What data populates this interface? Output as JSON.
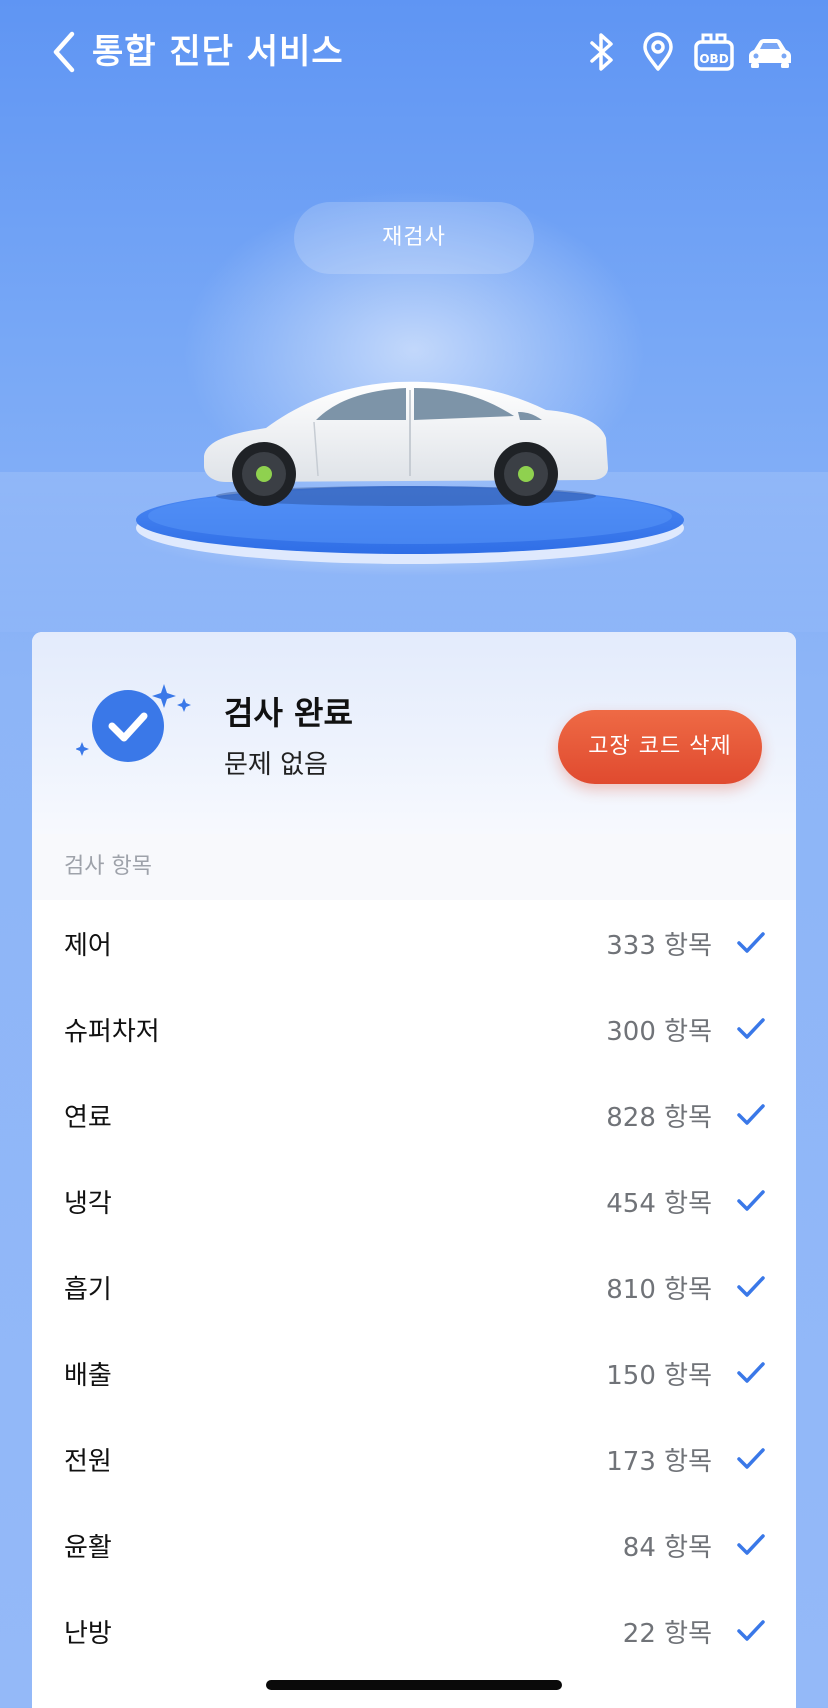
{
  "header": {
    "title": "통합 진단 서비스",
    "icons": [
      "back-chevron-icon",
      "bluetooth-icon",
      "location-pin-icon",
      "obd-icon",
      "car-icon"
    ],
    "obd_label": "OBD"
  },
  "hero": {
    "recheck_label": "재검사"
  },
  "result": {
    "title": "검사 완료",
    "subtitle": "문제 없음",
    "clear_button": "고장 코드 삭제"
  },
  "items_section": {
    "label": "검사 항목",
    "rows": [
      {
        "name": "제어",
        "count": "333 항목"
      },
      {
        "name": "슈퍼차저",
        "count": "300 항목"
      },
      {
        "name": "연료",
        "count": "828 항목"
      },
      {
        "name": "냉각",
        "count": "454 항목"
      },
      {
        "name": "흡기",
        "count": "810 항목"
      },
      {
        "name": "배출",
        "count": "150 항목"
      },
      {
        "name": "전원",
        "count": "173 항목"
      },
      {
        "name": "윤활",
        "count": "84 항목"
      },
      {
        "name": "난방",
        "count": "22 항목"
      }
    ]
  },
  "colors": {
    "accent": "#3a78e8",
    "button": "#e5553a",
    "header_bg": "#6b9cf3"
  }
}
